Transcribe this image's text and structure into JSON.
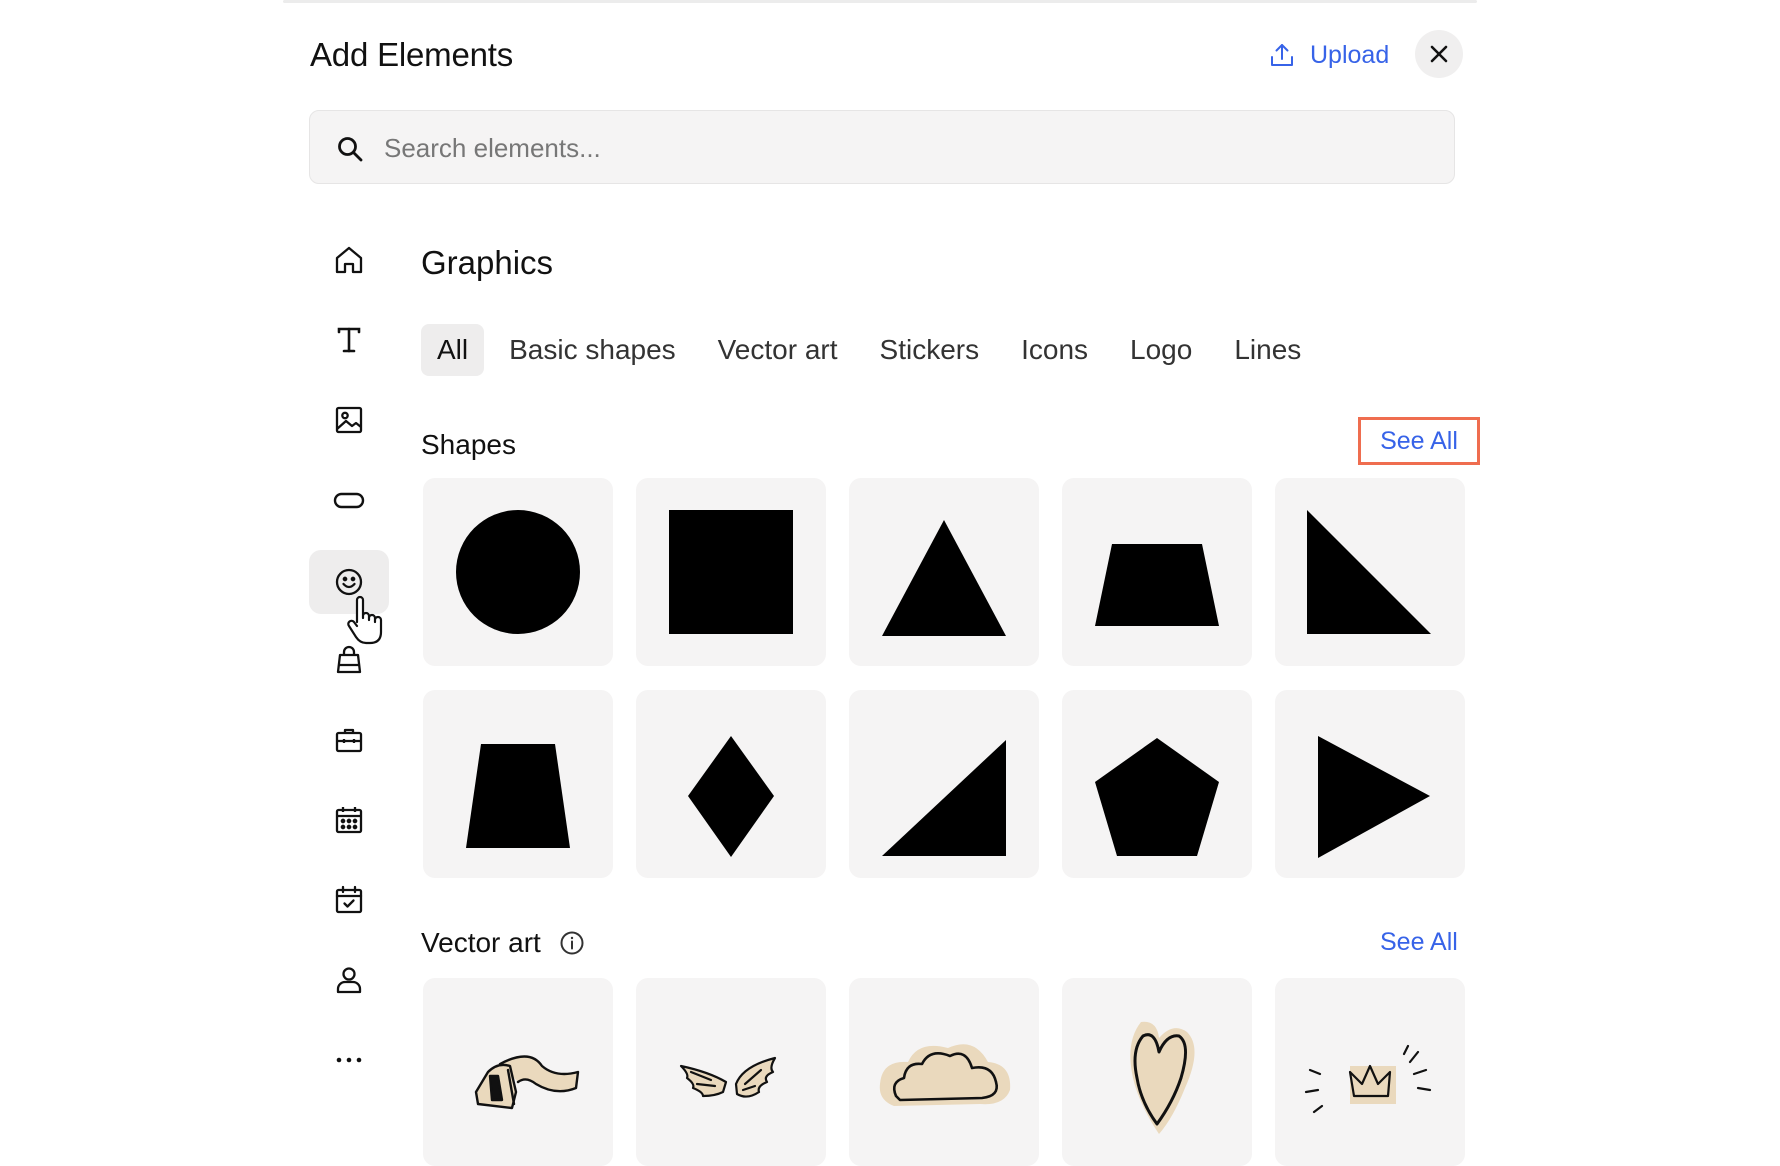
{
  "panel": {
    "title": "Add Elements",
    "upload_label": "Upload",
    "close_icon": "close-icon"
  },
  "search": {
    "placeholder": "Search elements..."
  },
  "sidebar": {
    "items": [
      {
        "icon": "home-icon",
        "active": false
      },
      {
        "icon": "text-icon",
        "active": false
      },
      {
        "icon": "image-icon",
        "active": false
      },
      {
        "icon": "button-icon",
        "active": false
      },
      {
        "icon": "smiley-icon",
        "active": true
      },
      {
        "icon": "shopping-bag-icon",
        "active": false
      },
      {
        "icon": "briefcase-icon",
        "active": false
      },
      {
        "icon": "calendar-grid-icon",
        "active": false
      },
      {
        "icon": "calendar-check-icon",
        "active": false
      },
      {
        "icon": "person-icon",
        "active": false
      },
      {
        "icon": "more-icon",
        "active": false
      }
    ]
  },
  "main": {
    "section_title": "Graphics",
    "tabs": [
      {
        "label": "All",
        "active": true
      },
      {
        "label": "Basic shapes",
        "active": false
      },
      {
        "label": "Vector art",
        "active": false
      },
      {
        "label": "Stickers",
        "active": false
      },
      {
        "label": "Icons",
        "active": false
      },
      {
        "label": "Logo",
        "active": false
      },
      {
        "label": "Lines",
        "active": false
      }
    ],
    "shapes": {
      "title": "Shapes",
      "see_all": "See All",
      "items": [
        "circle",
        "square",
        "triangle",
        "trapezoid",
        "right-triangle",
        "tall-trapezoid",
        "diamond",
        "right-triangle-flipped",
        "pentagon",
        "play-triangle"
      ]
    },
    "vector_art": {
      "title": "Vector art",
      "info_icon": "info-icon",
      "see_all": "See All",
      "items": [
        "telephone-art",
        "wings-art",
        "cloud-art",
        "heart-art",
        "crown-art"
      ]
    }
  },
  "colors": {
    "accent": "#3763e8",
    "highlight_border": "#ef6d4f",
    "tile_bg": "#f5f4f4",
    "art_fill": "#ead9bd"
  }
}
